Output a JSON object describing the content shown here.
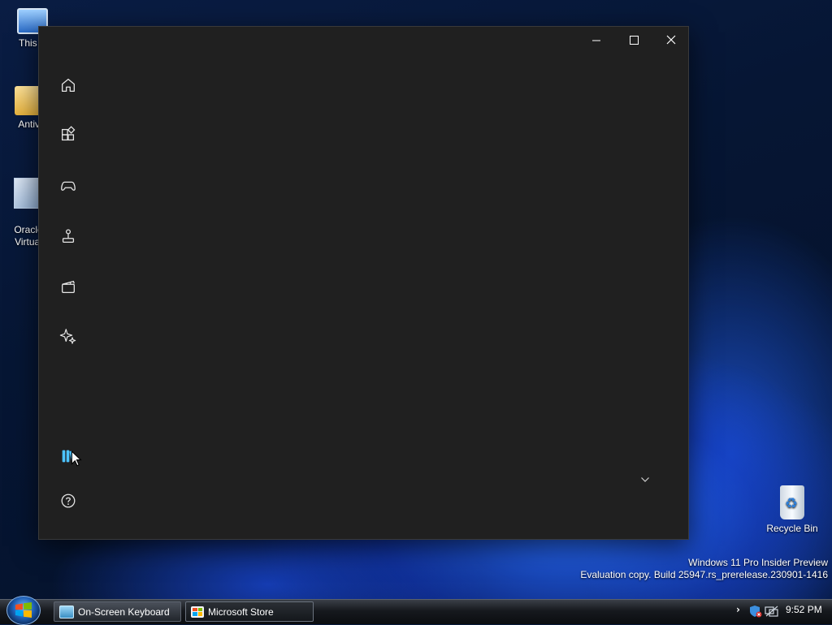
{
  "desktop": {
    "icons": [
      {
        "label": "This P"
      },
      {
        "label": "Antivi"
      },
      {
        "label": "Oracle\nVirtual"
      }
    ],
    "recycle_bin": {
      "label": "Recycle Bin"
    },
    "watermark": {
      "line1": "Windows 11 Pro Insider Preview",
      "line2": "Evaluation copy. Build 25947.rs_prerelease.230901-1416"
    }
  },
  "window": {
    "caption": {
      "minimize": "—",
      "maximize": "☐",
      "close": "✕"
    },
    "nav_items": [
      {
        "name": "home",
        "icon": "home-icon"
      },
      {
        "name": "apps",
        "icon": "apps-icon"
      },
      {
        "name": "gaming",
        "icon": "game-controller-icon"
      },
      {
        "name": "arcade",
        "icon": "joystick-icon"
      },
      {
        "name": "movies-tv",
        "icon": "clapperboard-icon"
      },
      {
        "name": "ai-hub",
        "icon": "sparkle-icon"
      },
      {
        "name": "library",
        "icon": "library-icon",
        "active": true
      },
      {
        "name": "help",
        "icon": "help-icon"
      }
    ],
    "accent_color": "#4cc2ff"
  },
  "taskbar": {
    "buttons": [
      {
        "label": "On-Screen Keyboard"
      },
      {
        "label": "Microsoft Store",
        "active": true
      }
    ],
    "tray": {
      "expand": "›",
      "time": "9:52 PM"
    }
  }
}
